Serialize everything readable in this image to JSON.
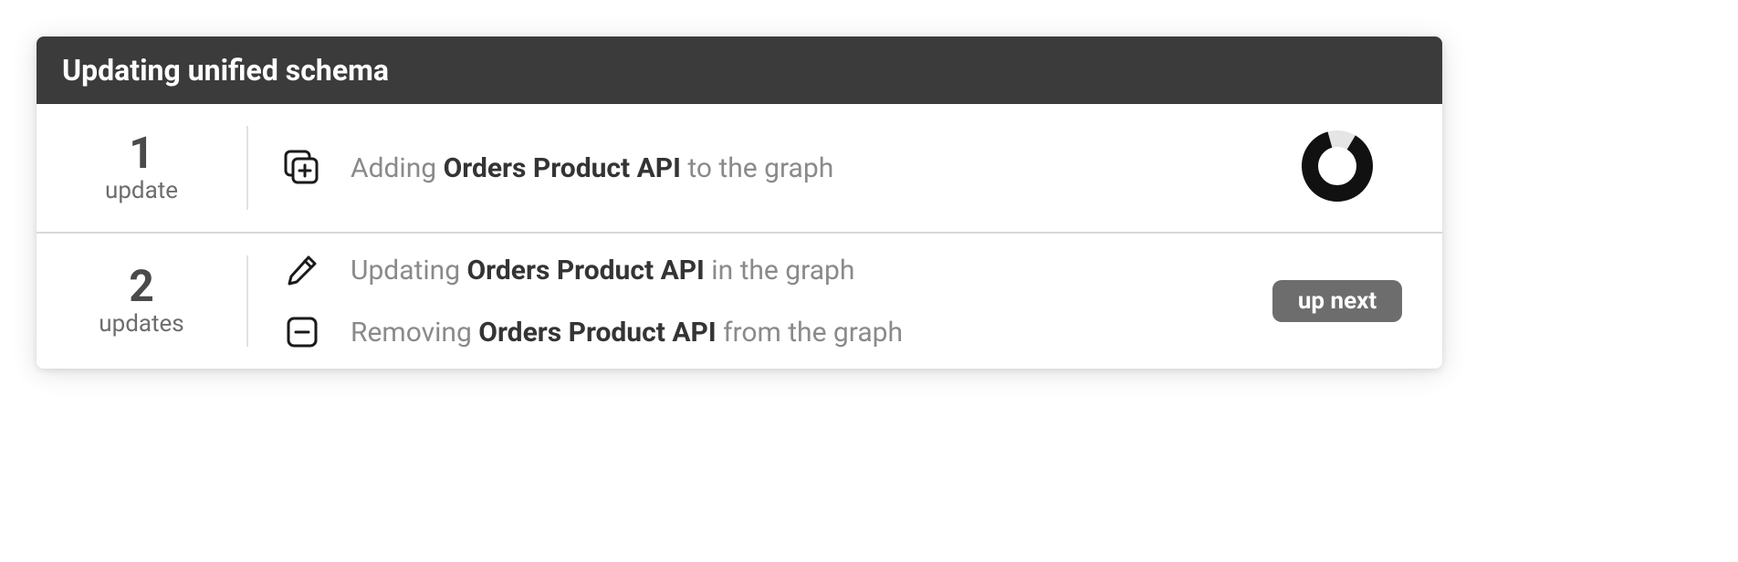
{
  "header": {
    "title": "Updating unified schema"
  },
  "sections": [
    {
      "count": "1",
      "count_label": "update",
      "status_type": "spinner",
      "items": [
        {
          "icon": "add",
          "prefix": "Adding ",
          "subject": "Orders Product API",
          "suffix": " to the graph"
        }
      ]
    },
    {
      "count": "2",
      "count_label": "updates",
      "status_type": "badge",
      "badge_label": "up next",
      "items": [
        {
          "icon": "edit",
          "prefix": "Updating ",
          "subject": "Orders Product API",
          "suffix": " in the graph"
        },
        {
          "icon": "remove",
          "prefix": "Removing ",
          "subject": "Orders Product API",
          "suffix": " from the graph"
        }
      ]
    }
  ]
}
